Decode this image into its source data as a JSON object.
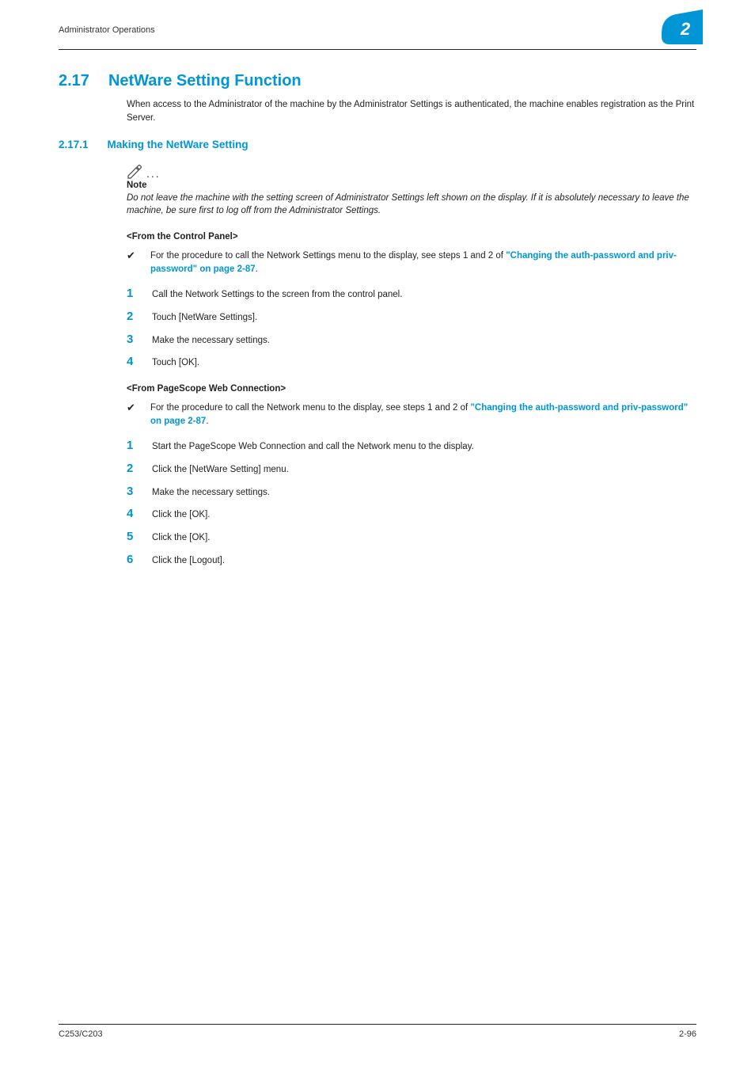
{
  "header": {
    "title": "Administrator Operations",
    "chapter_number": "2"
  },
  "h1": {
    "num": "2.17",
    "txt": "NetWare Setting Function"
  },
  "intro": "When access to the Administrator of the machine by the Administrator Settings is authenticated, the machine enables registration as the Print Server.",
  "h2": {
    "num": "2.17.1",
    "txt": "Making the NetWare Setting"
  },
  "note": {
    "label": "Note",
    "body": "Do not leave the machine with the setting screen of Administrator Settings left shown on the display. If it is absolutely necessary to leave the machine, be sure first to log off from the Administrator Settings."
  },
  "panel": {
    "heading": "<From the Control Panel>",
    "check_pre": "For the procedure to call the Network Settings menu to the display, see steps 1 and 2 of ",
    "check_link": "\"Changing the auth-password and priv-password\" on page 2-87",
    "check_post": ".",
    "steps": [
      "Call the Network Settings to the screen from the control panel.",
      "Touch [NetWare Settings].",
      "Make the necessary settings.",
      "Touch [OK]."
    ]
  },
  "web": {
    "heading": "<From PageScope Web Connection>",
    "check_pre": "For the procedure to call the Network menu to the display, see steps 1 and 2 of ",
    "check_link": "\"Changing the auth-password and priv-password\" on page 2-87",
    "check_post": ".",
    "steps": [
      "Start the PageScope Web Connection and call the Network menu to the display.",
      "Click the [NetWare Setting] menu.",
      "Make the necessary settings.",
      "Click the [OK].",
      "Click the [OK].",
      "Click the [Logout]."
    ]
  },
  "footer": {
    "left": "C253/C203",
    "right": "2-96"
  }
}
